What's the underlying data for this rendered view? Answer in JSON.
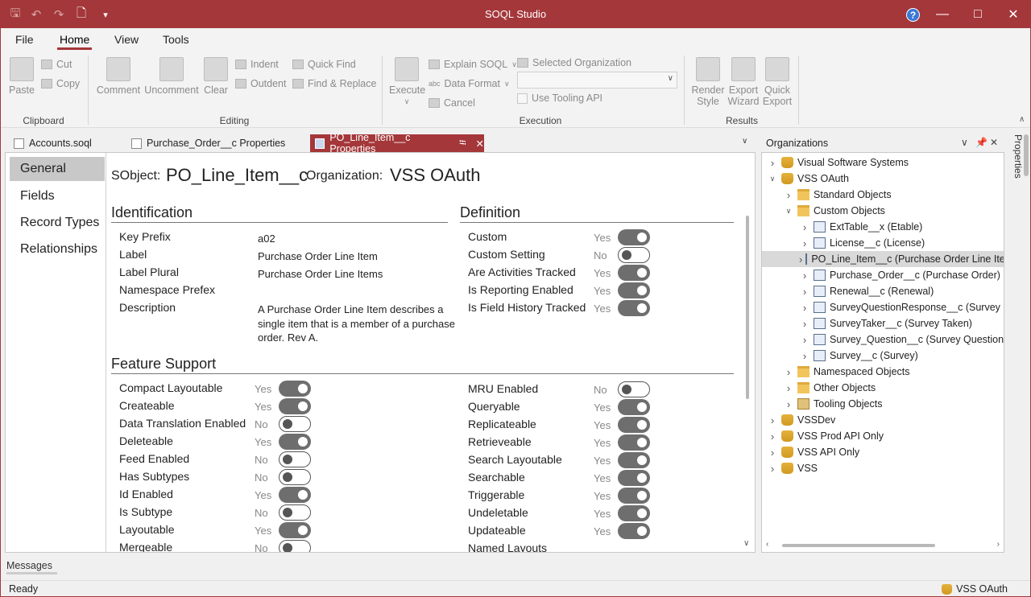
{
  "app": {
    "title": "SOQL Studio",
    "quick_access": [
      "save-icon",
      "undo-icon",
      "redo-icon",
      "new-document-icon",
      "customize-icon"
    ]
  },
  "menu": [
    "File",
    "Home",
    "View",
    "Tools"
  ],
  "ribbon": {
    "clipboard": {
      "label": "Clipboard",
      "paste": "Paste",
      "cut": "Cut",
      "copy": "Copy"
    },
    "editing": {
      "label": "Editing",
      "comment": "Comment",
      "uncomment": "Uncomment",
      "clear": "Clear",
      "indent": "Indent",
      "outdent": "Outdent",
      "quick_find": "Quick Find",
      "find_replace": "Find & Replace"
    },
    "execution": {
      "label": "Execution",
      "execute": "Execute",
      "explain": "Explain SOQL",
      "data_format": "Data Format",
      "cancel": "Cancel",
      "selected_org": "Selected Organization",
      "use_tooling": "Use Tooling API",
      "abc": "abc"
    },
    "results": {
      "label": "Results",
      "render_style": [
        "Render",
        "Style"
      ],
      "export_wizard": [
        "Export",
        "Wizard"
      ],
      "quick_export": [
        "Quick",
        "Export"
      ]
    }
  },
  "doc_tabs": [
    "Accounts.soql",
    "Purchase_Order__c Properties",
    "PO_Line_Item__c Properties"
  ],
  "nav": [
    "General",
    "Fields",
    "Record Types",
    "Relationships"
  ],
  "header": {
    "sobject_label": "SObject:",
    "sobject_value": "PO_Line_Item__c",
    "org_label": "Organization:",
    "org_value": "VSS OAuth"
  },
  "identification": {
    "title": "Identification",
    "rows": [
      {
        "label": "Key Prefix",
        "value": "a02"
      },
      {
        "label": "Label",
        "value": "Purchase Order Line Item"
      },
      {
        "label": "Label Plural",
        "value": "Purchase Order Line Items"
      },
      {
        "label": "Namespace Prefex",
        "value": ""
      },
      {
        "label": "Description",
        "value": "A Purchase Order Line Item describes a single item that is a member of a purchase order. Rev A."
      }
    ]
  },
  "definition": {
    "title": "Definition",
    "rows": [
      {
        "label": "Custom",
        "value": "Yes",
        "on": true
      },
      {
        "label": "Custom Setting",
        "value": "No",
        "on": false
      },
      {
        "label": "Are Activities Tracked",
        "value": "Yes",
        "on": true
      },
      {
        "label": "Is Reporting Enabled",
        "value": "Yes",
        "on": true
      },
      {
        "label": "Is Field History Tracked",
        "value": "Yes",
        "on": true
      }
    ]
  },
  "features": {
    "title": "Feature Support",
    "left": [
      {
        "label": "Compact Layoutable",
        "value": "Yes",
        "on": true
      },
      {
        "label": "Createable",
        "value": "Yes",
        "on": true
      },
      {
        "label": "Data Translation Enabled",
        "value": "No",
        "on": false
      },
      {
        "label": "Deleteable",
        "value": "Yes",
        "on": true
      },
      {
        "label": "Feed Enabled",
        "value": "No",
        "on": false
      },
      {
        "label": "Has Subtypes",
        "value": "No",
        "on": false
      },
      {
        "label": "Id Enabled",
        "value": "Yes",
        "on": true
      },
      {
        "label": "Is Subtype",
        "value": "No",
        "on": false
      },
      {
        "label": "Layoutable",
        "value": "Yes",
        "on": true
      },
      {
        "label": "Mergeable",
        "value": "No",
        "on": false
      }
    ],
    "right": [
      {
        "label": "MRU Enabled",
        "value": "No",
        "on": false
      },
      {
        "label": "Queryable",
        "value": "Yes",
        "on": true
      },
      {
        "label": "Replicateable",
        "value": "Yes",
        "on": true
      },
      {
        "label": "Retrieveable",
        "value": "Yes",
        "on": true
      },
      {
        "label": "Search Layoutable",
        "value": "Yes",
        "on": true
      },
      {
        "label": "Searchable",
        "value": "Yes",
        "on": true
      },
      {
        "label": "Triggerable",
        "value": "Yes",
        "on": true
      },
      {
        "label": "Undeletable",
        "value": "Yes",
        "on": true
      },
      {
        "label": "Updateable",
        "value": "Yes",
        "on": true
      },
      {
        "label": "Named Layouts",
        "value": "",
        "on": null
      }
    ]
  },
  "organizations": {
    "title": "Organizations",
    "tree": [
      {
        "label": "Visual Software Systems",
        "depth": 0,
        "icon": "database-icon",
        "exp": "collapsed"
      },
      {
        "label": "VSS OAuth",
        "depth": 0,
        "icon": "database-icon",
        "exp": "expanded"
      },
      {
        "label": "Standard Objects",
        "depth": 1,
        "icon": "folder-icon",
        "exp": "collapsed"
      },
      {
        "label": "Custom Objects",
        "depth": 1,
        "icon": "folder-open-icon",
        "exp": "expanded"
      },
      {
        "label": "ExtTable__x (Etable)",
        "depth": 2,
        "icon": "object-icon",
        "exp": "collapsed"
      },
      {
        "label": "License__c (License)",
        "depth": 2,
        "icon": "object-icon",
        "exp": "collapsed"
      },
      {
        "label": "PO_Line_Item__c (Purchase Order Line Ite",
        "depth": 2,
        "icon": "object-icon",
        "exp": "collapsed",
        "selected": true
      },
      {
        "label": "Purchase_Order__c (Purchase Order)",
        "depth": 2,
        "icon": "object-icon",
        "exp": "collapsed"
      },
      {
        "label": "Renewal__c (Renewal)",
        "depth": 2,
        "icon": "object-icon",
        "exp": "collapsed"
      },
      {
        "label": "SurveyQuestionResponse__c (Survey Ques",
        "depth": 2,
        "icon": "object-icon",
        "exp": "collapsed"
      },
      {
        "label": "SurveyTaker__c (Survey Taken)",
        "depth": 2,
        "icon": "object-icon",
        "exp": "collapsed"
      },
      {
        "label": "Survey_Question__c (Survey Question)",
        "depth": 2,
        "icon": "object-icon",
        "exp": "collapsed"
      },
      {
        "label": "Survey__c (Survey)",
        "depth": 2,
        "icon": "object-icon",
        "exp": "collapsed"
      },
      {
        "label": "Namespaced Objects",
        "depth": 1,
        "icon": "folder-icon",
        "exp": "collapsed"
      },
      {
        "label": "Other Objects",
        "depth": 1,
        "icon": "folder-icon",
        "exp": "collapsed"
      },
      {
        "label": "Tooling Objects",
        "depth": 1,
        "icon": "tooling-icon",
        "exp": "collapsed"
      },
      {
        "label": "VSSDev",
        "depth": 0,
        "icon": "database-error-icon",
        "exp": "collapsed"
      },
      {
        "label": "VSS Prod API Only",
        "depth": 0,
        "icon": "database-icon",
        "exp": "collapsed"
      },
      {
        "label": "VSS API Only",
        "depth": 0,
        "icon": "database-icon",
        "exp": "collapsed"
      },
      {
        "label": "VSS",
        "depth": 0,
        "icon": "database-icon",
        "exp": "collapsed"
      }
    ]
  },
  "properties_strip": "Properties",
  "messages_tab": "Messages",
  "status": {
    "text": "Ready",
    "org": "VSS OAuth"
  },
  "colors": {
    "accent": "#a4373a",
    "toggle_on": "#6e6e6e"
  }
}
